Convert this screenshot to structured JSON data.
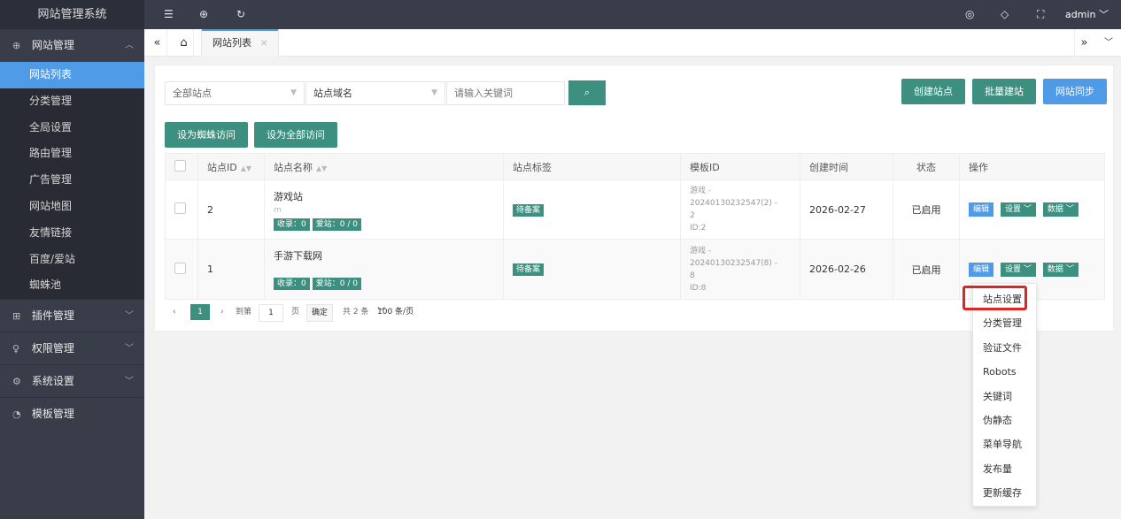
{
  "sidebar": {
    "logo": "网站管理系统",
    "groups": [
      {
        "label": "网站管理",
        "icon": "globe-icon",
        "open": true,
        "items": [
          "网站列表",
          "分类管理",
          "全局设置",
          "路由管理",
          "广告管理",
          "网站地图",
          "友情链接",
          "百度/爱站",
          "蜘蛛池"
        ]
      },
      {
        "label": "插件管理",
        "icon": "plugin-icon"
      },
      {
        "label": "权限管理",
        "icon": "key-icon"
      },
      {
        "label": "系统设置",
        "icon": "gear-icon"
      },
      {
        "label": "模板管理",
        "icon": "palette-icon"
      }
    ]
  },
  "topbar": {
    "user": "admin"
  },
  "tabs": {
    "current": "网站列表"
  },
  "filters": {
    "site_select": "全部站点",
    "field_select": "站点域名",
    "keyword_placeholder": "请输入关键词"
  },
  "buttons": {
    "create": "创建站点",
    "batch": "批量建站",
    "sync": "网站同步",
    "spider_access": "设为蜘蛛访问",
    "all_access": "设为全部访问"
  },
  "table": {
    "headers": [
      "站点ID",
      "站点名称",
      "站点标签",
      "模板ID",
      "创建时间",
      "状态",
      "操作"
    ],
    "rows": [
      {
        "id": "2",
        "name": "游戏站",
        "domain": "m",
        "tag": "待备案",
        "tmpl_line1": "游戏 - 20240130232547(2) -",
        "tmpl_line2": "2",
        "tmpl_line3": "ID:2",
        "date": "2026-02-27",
        "status": "已启用"
      },
      {
        "id": "1",
        "name": "手游下载网",
        "domain": "",
        "tag": "待备案",
        "tmpl_line1": "游戏 - 20240130232547(8) -",
        "tmpl_line2": "8",
        "tmpl_line3": "ID:8",
        "date": "2026-02-26",
        "status": "已启用"
      }
    ],
    "row_tags": {
      "shoulu": "收录：0",
      "aizhan": "爱站：0 / 0"
    },
    "ops": {
      "edit": "编辑",
      "settings": "设置",
      "data": "数据"
    }
  },
  "pager": {
    "current": "1",
    "goto": "到第",
    "page_input": "1",
    "page_unit": "页",
    "ok": "确定",
    "total": "共 2 条",
    "size": "100 条/页"
  },
  "dropdown": {
    "items": [
      "站点设置",
      "分类管理",
      "验证文件",
      "Robots",
      "关键词",
      "伪静态",
      "菜单导航",
      "发布量",
      "更新缓存"
    ]
  },
  "colors": {
    "accent_blue": "#509be8",
    "accent_green": "#3d8f80",
    "sidebar_bg": "#393d49",
    "highlight": "#e02424"
  }
}
